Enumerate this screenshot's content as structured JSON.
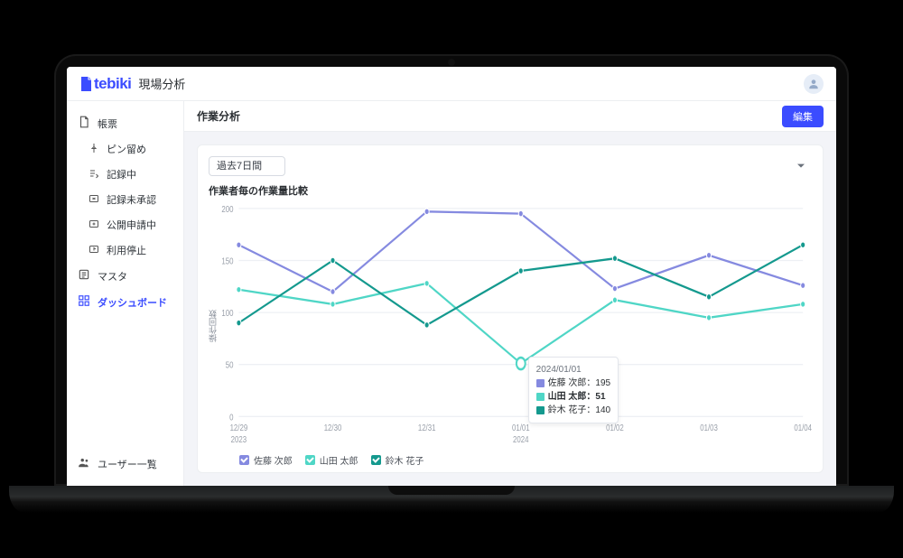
{
  "brand": {
    "name": "tebiki",
    "subtitle": "現場分析"
  },
  "sidebar": {
    "items": [
      {
        "label": "帳票",
        "icon": "document-icon"
      },
      {
        "label": "ピン留め",
        "icon": "pin-icon"
      },
      {
        "label": "記録中",
        "icon": "edit-list-icon"
      },
      {
        "label": "記録未承認",
        "icon": "folder-x-icon"
      },
      {
        "label": "公開申請中",
        "icon": "folder-plus-icon"
      },
      {
        "label": "利用停止",
        "icon": "folder-stop-icon"
      },
      {
        "label": "マスタ",
        "icon": "list-icon"
      },
      {
        "label": "ダッシュボード",
        "icon": "dashboard-icon"
      }
    ],
    "footer": {
      "label": "ユーザー一覧",
      "icon": "users-icon"
    }
  },
  "page": {
    "title": "作業分析",
    "edit_label": "編集"
  },
  "period": {
    "selected": "過去7日間"
  },
  "chart_data": {
    "type": "line",
    "title": "作業者毎の作業量比較",
    "ylabel": "操作回数",
    "ylim": [
      0,
      200
    ],
    "yticks": [
      0,
      50,
      100,
      150,
      200
    ],
    "categories": [
      "12/29",
      "12/30",
      "12/31",
      "01/01",
      "01/02",
      "01/03",
      "01/04"
    ],
    "category_sublabels": {
      "0": "2023",
      "3": "2024"
    },
    "series": [
      {
        "name": "佐藤 次郎",
        "color": "#858ae0",
        "values": [
          165,
          120,
          197,
          195,
          123,
          155,
          126
        ]
      },
      {
        "name": "山田 太郎",
        "color": "#4fd6c6",
        "values": [
          122,
          108,
          128,
          51,
          112,
          95,
          108
        ]
      },
      {
        "name": "鈴木 花子",
        "color": "#14998e",
        "values": [
          90,
          150,
          88,
          140,
          152,
          115,
          165
        ]
      }
    ],
    "tooltip": {
      "category_index": 3,
      "date_label": "2024/01/01",
      "highlight_series_index": 1
    }
  },
  "colors": {
    "primary": "#3b4cff"
  }
}
